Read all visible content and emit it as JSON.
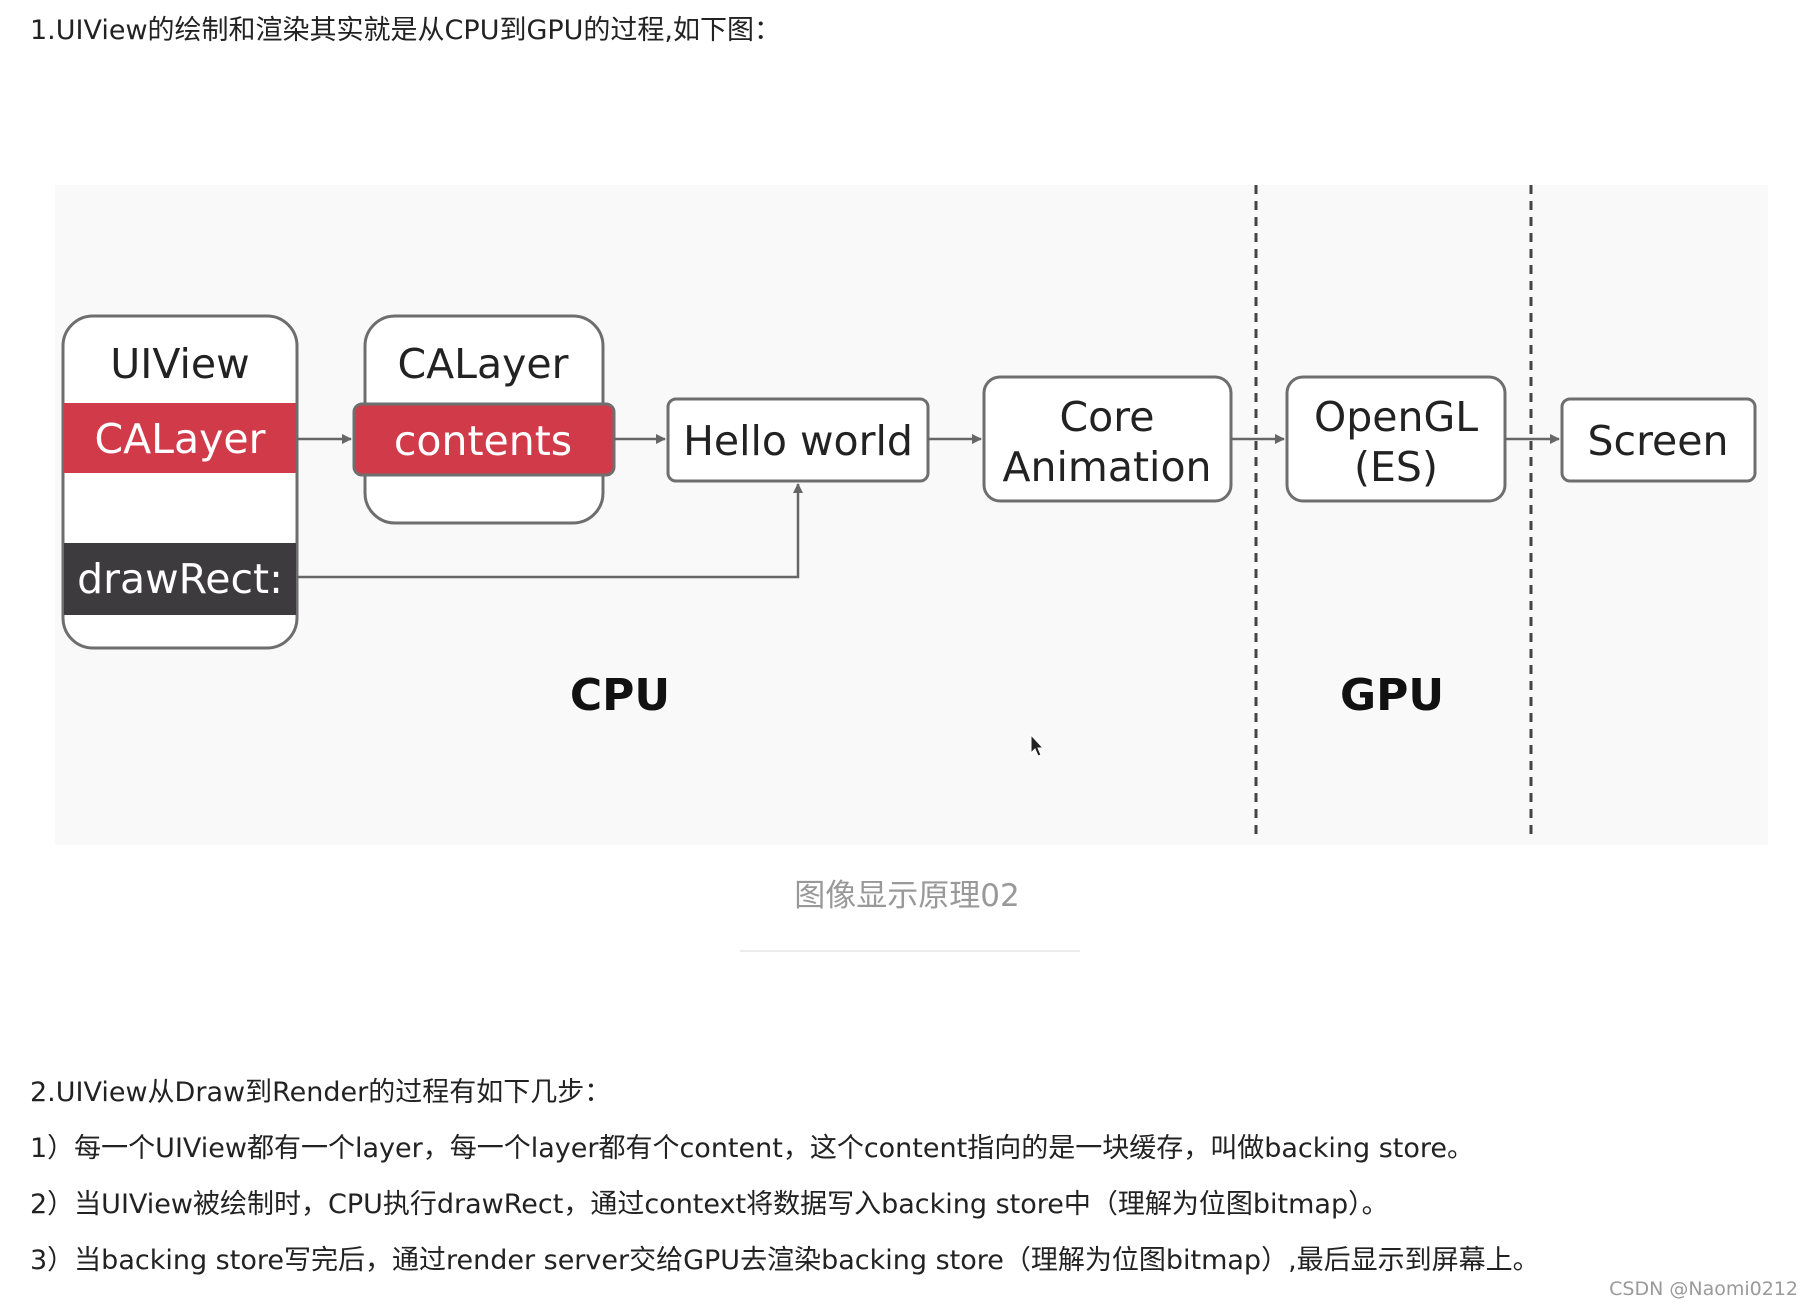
{
  "intro": "1.UIView的绘制和渲染其实就是从CPU到GPU的过程,如下图：",
  "diagram": {
    "uiview": {
      "title": "UIView",
      "layer": "CALayer",
      "draw": "drawRect:"
    },
    "calayer": {
      "title": "CALayer",
      "contents": "contents"
    },
    "hello": "Hello world",
    "core_animation": [
      "Core",
      "Animation"
    ],
    "opengl": [
      "OpenGL",
      "(ES)"
    ],
    "screen": "Screen",
    "cpu_label": "CPU",
    "gpu_label": "GPU",
    "colors": {
      "red": "#d13a49",
      "dark": "#3d3b3e",
      "border": "#6e6e6e",
      "background": "#f9f9f9"
    }
  },
  "caption": "图像显示原理02",
  "steps": {
    "heading": "2.UIView从Draw到Render的过程有如下几步：",
    "items": [
      "1）每一个UIView都有一个layer，每一个layer都有个content，这个content指向的是一块缓存，叫做backing store。",
      "2）当UIView被绘制时，CPU执行drawRect，通过context将数据写入backing store中（理解为位图bitmap）。",
      "3）当backing store写完后，通过render server交给GPU去渲染backing store（理解为位图bitmap）,最后显示到屏幕上。"
    ]
  },
  "watermark": "CSDN @Naomi0212"
}
